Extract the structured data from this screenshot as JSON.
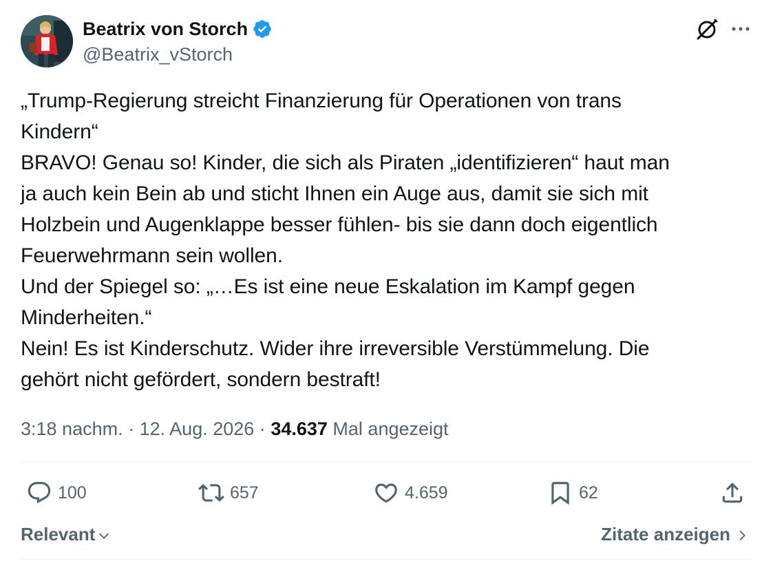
{
  "author": {
    "display_name": "Beatrix von Storch",
    "handle": "@Beatrix_vStorch",
    "verified": true,
    "verified_color": "#1d9bf0"
  },
  "icons": {
    "header": [
      "grok-icon",
      "more-options-icon"
    ],
    "actions": [
      "reply-icon",
      "repost-icon",
      "like-icon",
      "bookmark-icon",
      "share-icon"
    ]
  },
  "tweet": {
    "text": "„Trump-Regierung streicht Finanzierung für Operationen von trans\nKindern“\nBRAVO! Genau so! Kinder, die sich als Piraten „identifizieren“ haut man\nja auch kein Bein ab und sticht Ihnen ein Auge aus, damit sie sich mit\nHolzbein und Augenklappe besser fühlen- bis sie dann doch eigentlich\nFeuerwehrmann sein wollen.\nUnd der Spiegel so: „…Es ist eine neue Eskalation im Kampf gegen\nMinderheiten.“\nNein! Es ist Kinderschutz. Wider ihre irreversible Verstümmelung. Die\ngehört nicht gefördert, sondern bestraft!"
  },
  "meta": {
    "time": "3:18 nachm.",
    "separator": "·",
    "date": "12. Aug. 2026",
    "views_count": "34.637",
    "views_label": "Mal angezeigt"
  },
  "actions": {
    "replies": "100",
    "reposts": "657",
    "likes": "4.659",
    "bookmarks": "62"
  },
  "footer": {
    "sort_label": "Relevant",
    "quotes_label": "Zitate anzeigen"
  },
  "colors": {
    "text_primary": "#0f1419",
    "text_secondary": "#536471",
    "divider": "#eff3f4"
  }
}
